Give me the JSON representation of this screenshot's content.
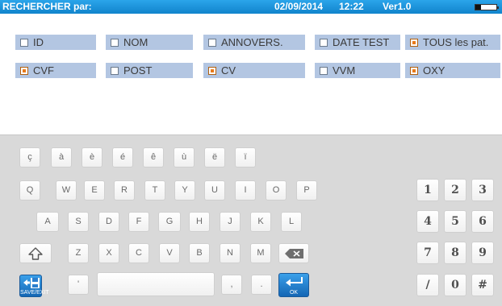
{
  "header": {
    "title": "RECHERCHER par:",
    "date": "02/09/2014",
    "time": "12:22",
    "version": "Ver1.0"
  },
  "filters": {
    "row1": [
      {
        "label": "ID",
        "checked": false
      },
      {
        "label": "NOM",
        "checked": false
      },
      {
        "label": "ANNOVERS.",
        "checked": false
      },
      {
        "label": "DATE TEST",
        "checked": false
      },
      {
        "label": "TOUS les pat.",
        "checked": true
      }
    ],
    "row2": [
      {
        "label": "CVF",
        "checked": true
      },
      {
        "label": "POST",
        "checked": false
      },
      {
        "label": "CV",
        "checked": true
      },
      {
        "label": "VVM",
        "checked": false
      },
      {
        "label": "OXY",
        "checked": true
      }
    ]
  },
  "keyboard": {
    "accents": [
      "ç",
      "à",
      "è",
      "é",
      "ê",
      "ù",
      "ë",
      "ï"
    ],
    "row_q": [
      "Q",
      "W",
      "E",
      "R",
      "T",
      "Y",
      "U",
      "I",
      "O",
      "P"
    ],
    "row_a": [
      "A",
      "S",
      "D",
      "F",
      "G",
      "H",
      "J",
      "K",
      "L"
    ],
    "row_z": [
      "Z",
      "X",
      "C",
      "V",
      "B",
      "N",
      "M"
    ],
    "apostrophe": "'",
    "comma": ",",
    "period": ".",
    "save_label": "SAVE/EXIT",
    "ok_label": "OK",
    "numpad": [
      "1",
      "2",
      "3",
      "4",
      "5",
      "6",
      "7",
      "8",
      "9",
      "/",
      "0",
      "#"
    ]
  },
  "colors": {
    "header": "#1a93dc",
    "option_bg": "#b3c6e2",
    "checked_mark": "#e87a1a",
    "keyboard_bg": "#d9d9d9",
    "action_key": "#1f7ccc"
  },
  "icons": {
    "shift": "shift-arrow-icon",
    "backspace": "backspace-icon",
    "save": "floppy-disk-icon",
    "enter": "enter-arrow-icon",
    "battery": "battery-icon"
  }
}
